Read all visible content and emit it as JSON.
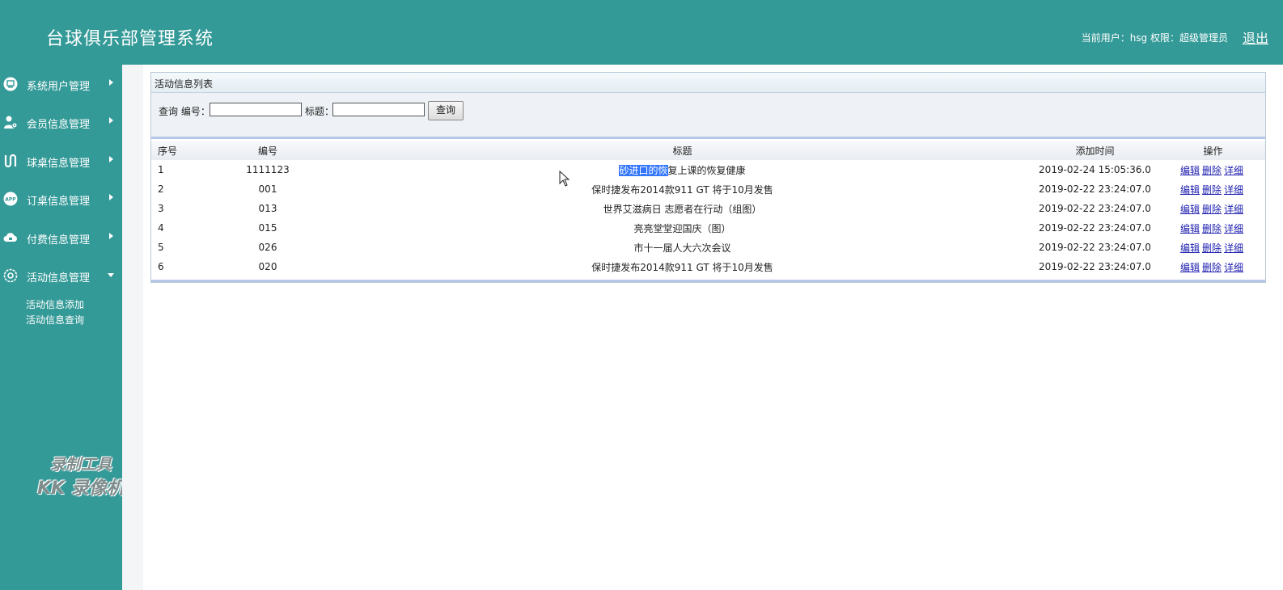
{
  "app": {
    "title": "台球俱乐部管理系统",
    "user_info": "当前用户：hsg  权限：超级管理员",
    "logout": "退出"
  },
  "sidebar": {
    "items": [
      {
        "label": "系统用户管理",
        "icon": "monitor-icon",
        "expanded": false
      },
      {
        "label": "会员信息管理",
        "icon": "user-gear-icon",
        "expanded": false
      },
      {
        "label": "球桌信息管理",
        "icon": "route-icon",
        "expanded": false
      },
      {
        "label": "订桌信息管理",
        "icon": "app-badge-icon",
        "expanded": false
      },
      {
        "label": "付费信息管理",
        "icon": "cloud-icon",
        "expanded": false
      },
      {
        "label": "活动信息管理",
        "icon": "settings-icon",
        "expanded": true
      }
    ],
    "subitems": [
      "活动信息添加",
      "活动信息查询"
    ]
  },
  "watermark": {
    "line1": "录制工具",
    "line2": "KK 录像机"
  },
  "panel": {
    "title": "活动信息列表",
    "search": {
      "prefix": "查询 编号：",
      "number_value": "",
      "title_label": "标题：",
      "title_value": "",
      "button": "查询"
    }
  },
  "table": {
    "headers": [
      "序号",
      "编号",
      "标题",
      "添加时间",
      "操作"
    ],
    "actions": [
      "编辑",
      "删除",
      "详细"
    ],
    "rows": [
      {
        "seq": "1",
        "number": "1111123",
        "title_selected": "砂进口的恢",
        "title_rest": "复上课的恢复健康",
        "time": "2019-02-24 15:05:36.0"
      },
      {
        "seq": "2",
        "number": "001",
        "title": "保时捷发布2014款911 GT 将于10月发售",
        "time": "2019-02-22 23:24:07.0"
      },
      {
        "seq": "3",
        "number": "013",
        "title": "世界艾滋病日 志愿者在行动（组图）",
        "time": "2019-02-22 23:24:07.0"
      },
      {
        "seq": "4",
        "number": "015",
        "title": "亮亮堂堂迎国庆（图）",
        "time": "2019-02-22 23:24:07.0"
      },
      {
        "seq": "5",
        "number": "026",
        "title": "市十一届人大六次会议",
        "time": "2019-02-22 23:24:07.0"
      },
      {
        "seq": "6",
        "number": "020",
        "title": "保时捷发布2014款911 GT 将于10月发售",
        "time": "2019-02-22 23:24:07.0"
      }
    ]
  }
}
